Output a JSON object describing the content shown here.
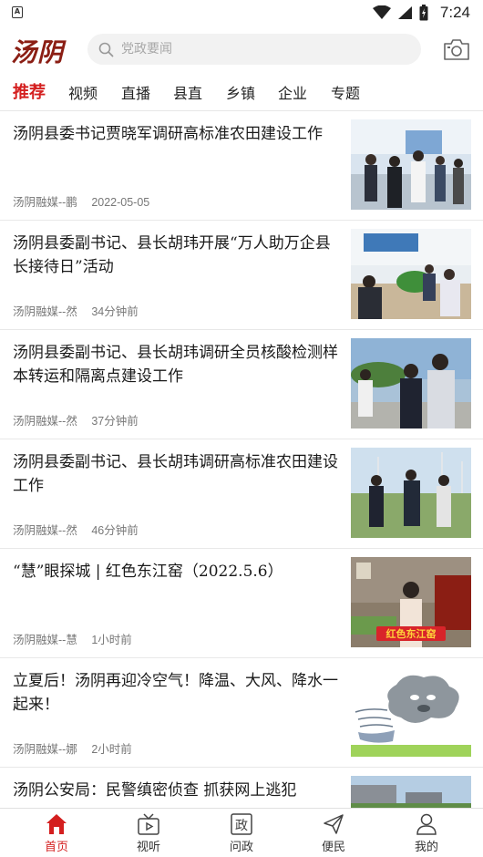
{
  "status_bar": {
    "time": "7:24",
    "notification_icon": "A"
  },
  "header": {
    "logo": "汤阴",
    "search_placeholder": "党政要闻"
  },
  "tabs": [
    {
      "label": "推荐",
      "active": true
    },
    {
      "label": "视频",
      "active": false
    },
    {
      "label": "直播",
      "active": false
    },
    {
      "label": "县直",
      "active": false
    },
    {
      "label": "乡镇",
      "active": false
    },
    {
      "label": "企业",
      "active": false
    },
    {
      "label": "专题",
      "active": false
    }
  ],
  "news": [
    {
      "title": "汤阴县委书记贾晓军调研高标准农田建设工作",
      "source": "汤阴融媒--鹏",
      "time": "2022-05-05"
    },
    {
      "title": "汤阴县委副书记、县长胡玮开展“万人助万企县长接待日”活动",
      "source": "汤阴融媒--然",
      "time": "34分钟前"
    },
    {
      "title": "汤阴县委副书记、县长胡玮调研全员核酸检测样本转运和隔离点建设工作",
      "source": "汤阴融媒--然",
      "time": "37分钟前"
    },
    {
      "title": "汤阴县委副书记、县长胡玮调研高标准农田建设工作",
      "source": "汤阴融媒--然",
      "time": "46分钟前"
    },
    {
      "title": "“慧”眼探城 | 红色东江窑（2022.5.6）",
      "source": "汤阴融媒--慧",
      "time": "1小时前",
      "thumb_caption": "红色东江窑"
    },
    {
      "title": "立夏后！汤阴再迎冷空气！降温、大风、降水一起来！",
      "source": "汤阴融媒--娜",
      "time": "2小时前"
    },
    {
      "title": "汤阴公安局：民警缜密侦查 抓获网上逃犯",
      "source": "",
      "time": ""
    }
  ],
  "bottom_nav": [
    {
      "label": "首页",
      "icon": "home-icon",
      "active": true
    },
    {
      "label": "视听",
      "icon": "tv-icon",
      "active": false
    },
    {
      "label": "问政",
      "icon": "zheng-icon",
      "active": false
    },
    {
      "label": "便民",
      "icon": "send-icon",
      "active": false
    },
    {
      "label": "我的",
      "icon": "user-icon",
      "active": false
    }
  ],
  "colors": {
    "accent": "#d41f1f",
    "logo": "#8b1e14"
  }
}
